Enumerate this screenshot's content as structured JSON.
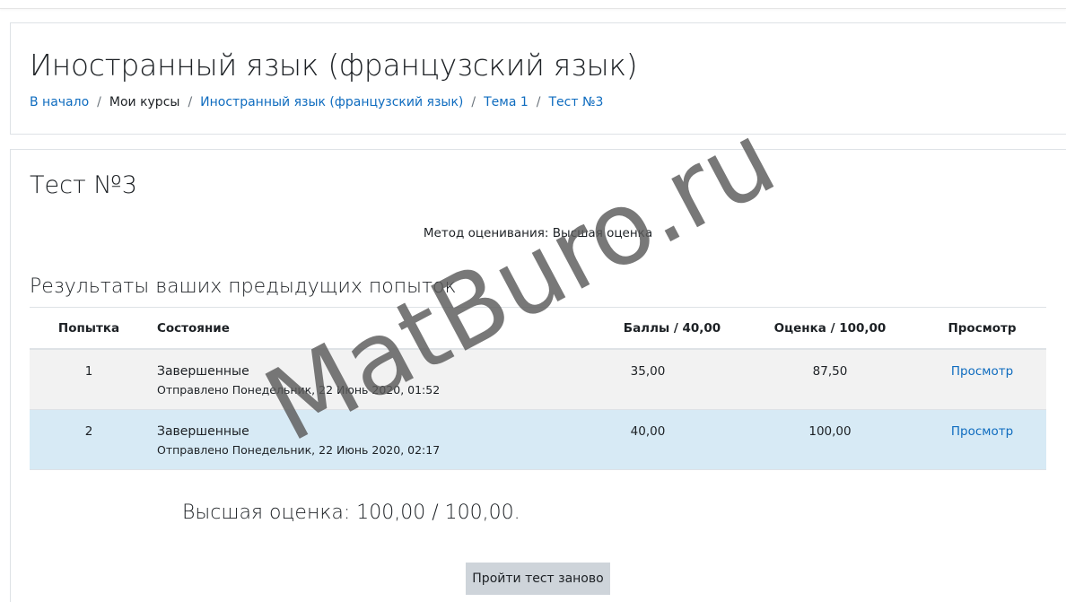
{
  "header": {
    "course_title": "Иностранный язык (французский язык)",
    "breadcrumb": [
      {
        "label": "В начало",
        "link": true
      },
      {
        "label": "Мои курсы",
        "link": false
      },
      {
        "label": "Иностранный язык (французский язык)",
        "link": true
      },
      {
        "label": "Тема 1",
        "link": true
      },
      {
        "label": "Тест №3",
        "link": true
      }
    ],
    "separator": "/"
  },
  "quiz": {
    "title": "Тест №3",
    "grading_method": "Метод оценивания: Высшая оценка",
    "results_heading": "Результаты ваших предыдущих попыток",
    "table": {
      "headers": {
        "attempt": "Попытка",
        "state": "Состояние",
        "marks": "Баллы / 40,00",
        "grade": "Оценка / 100,00",
        "review": "Просмотр"
      },
      "rows": [
        {
          "attempt": "1",
          "state": "Завершенные",
          "submitted": "Отправлено Понедельник, 22 Июнь 2020, 01:52",
          "marks": "35,00",
          "grade": "87,50",
          "review": "Просмотр"
        },
        {
          "attempt": "2",
          "state": "Завершенные",
          "submitted": "Отправлено Понедельник, 22 Июнь 2020, 02:17",
          "marks": "40,00",
          "grade": "100,00",
          "review": "Просмотр"
        }
      ]
    },
    "final_grade": "Высшая оценка: 100,00 / 100,00.",
    "retake_button": "Пройти тест заново"
  },
  "watermark": "MatBuro.ru",
  "colors": {
    "link": "#0f6cbf",
    "row_odd": "#f2f2f2",
    "row_highlight": "#d7eaf5",
    "button": "#ced4da"
  }
}
